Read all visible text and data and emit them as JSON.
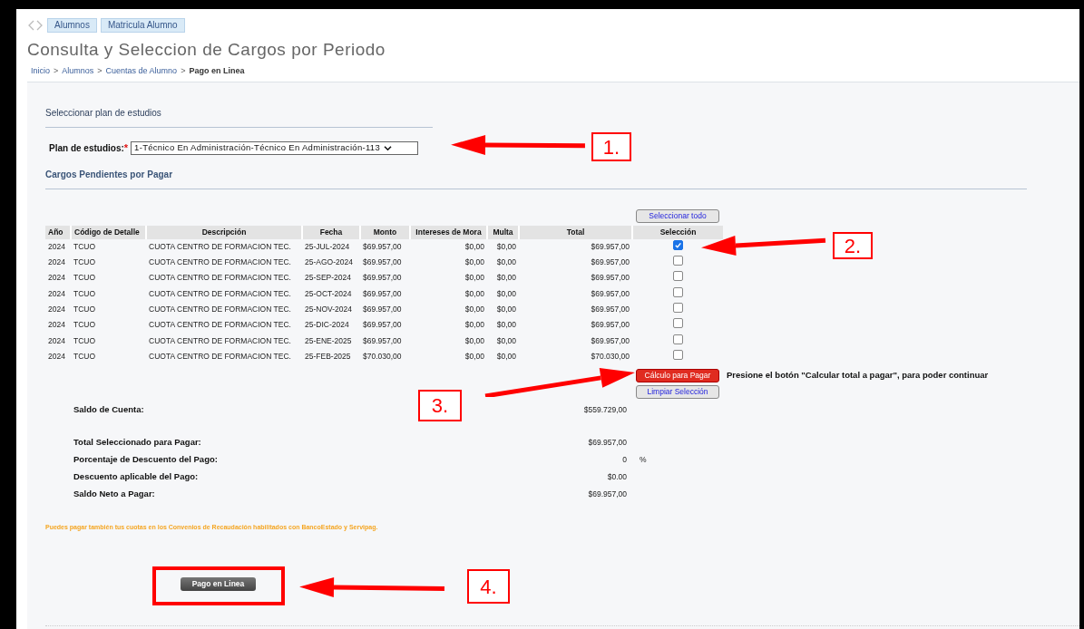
{
  "nav_tabs": [
    {
      "label": "Alumnos"
    },
    {
      "label": "Matricula Alumno"
    }
  ],
  "title": "Consulta y Seleccion de Cargos por Periodo",
  "breadcrumb": [
    {
      "label": "Inicio",
      "current": false
    },
    {
      "label": "Alumnos",
      "current": false
    },
    {
      "label": "Cuentas de Alumno",
      "current": false
    },
    {
      "label": "Pago en Linea",
      "current": true
    }
  ],
  "breadcrumb_separator": ">",
  "plan_section": {
    "heading": "Seleccionar plan de estudios",
    "label": "Plan de estudios:",
    "required_mark": "*",
    "value": "1-Técnico En Administración-Técnico En Administración-113"
  },
  "charges": {
    "heading": "Cargos Pendientes por Pagar",
    "select_all_button": "Seleccionar todo",
    "columns": [
      "Año",
      "Código de Detalle",
      "Descripción",
      "Fecha",
      "Monto",
      "Intereses de Mora",
      "Multa",
      "Total",
      "Selección"
    ],
    "rows": [
      {
        "cells": [
          "2024",
          "TCUO",
          "CUOTA CENTRO DE FORMACION TEC.",
          "25-JUL-2024",
          "$69.957,00",
          "$0,00",
          "$0,00",
          "$69.957,00"
        ],
        "checked": true
      },
      {
        "cells": [
          "2024",
          "TCUO",
          "CUOTA CENTRO DE FORMACION TEC.",
          "25-AGO-2024",
          "$69.957,00",
          "$0,00",
          "$0,00",
          "$69.957,00"
        ],
        "checked": false
      },
      {
        "cells": [
          "2024",
          "TCUO",
          "CUOTA CENTRO DE FORMACION TEC.",
          "25-SEP-2024",
          "$69.957,00",
          "$0,00",
          "$0,00",
          "$69.957,00"
        ],
        "checked": false
      },
      {
        "cells": [
          "2024",
          "TCUO",
          "CUOTA CENTRO DE FORMACION TEC.",
          "25-OCT-2024",
          "$69.957,00",
          "$0,00",
          "$0,00",
          "$69.957,00"
        ],
        "checked": false
      },
      {
        "cells": [
          "2024",
          "TCUO",
          "CUOTA CENTRO DE FORMACION TEC.",
          "25-NOV-2024",
          "$69.957,00",
          "$0,00",
          "$0,00",
          "$69.957,00"
        ],
        "checked": false
      },
      {
        "cells": [
          "2024",
          "TCUO",
          "CUOTA CENTRO DE FORMACION TEC.",
          "25-DIC-2024",
          "$69.957,00",
          "$0,00",
          "$0,00",
          "$69.957,00"
        ],
        "checked": false
      },
      {
        "cells": [
          "2024",
          "TCUO",
          "CUOTA CENTRO DE FORMACION TEC.",
          "25-ENE-2025",
          "$69.957,00",
          "$0,00",
          "$0,00",
          "$69.957,00"
        ],
        "checked": false
      },
      {
        "cells": [
          "2024",
          "TCUO",
          "CUOTA CENTRO DE FORMACION TEC.",
          "25-FEB-2025",
          "$70.030,00",
          "$0,00",
          "$0,00",
          "$70.030,00"
        ],
        "checked": false
      }
    ]
  },
  "calc_button": "Cálculo para Pagar",
  "calc_hint": "Presione el botón \"Calcular total a pagar\", para poder continuar",
  "clear_button": "Limpiar Selección",
  "summary": [
    {
      "label": "Saldo de Cuenta:",
      "value": "$559.729,00"
    },
    {
      "label": "Total Seleccionado para Pagar:",
      "value": "$69.957,00"
    },
    {
      "label": "Porcentaje de Descuento del Pago:",
      "value": "0",
      "unit": "%"
    },
    {
      "label": "Descuento aplicable del Pago:",
      "value": "$0.00"
    },
    {
      "label": "Saldo Neto a Pagar:",
      "value": "$69.957,00"
    }
  ],
  "note": "Puedes pagar también tus cuotas en los Convenios de Recaudación habilitados con BancoEstado y Servipag.",
  "pay_button": "Pago en Linea",
  "annotations": [
    {
      "number": "1."
    },
    {
      "number": "2."
    },
    {
      "number": "3."
    },
    {
      "number": "4."
    }
  ]
}
